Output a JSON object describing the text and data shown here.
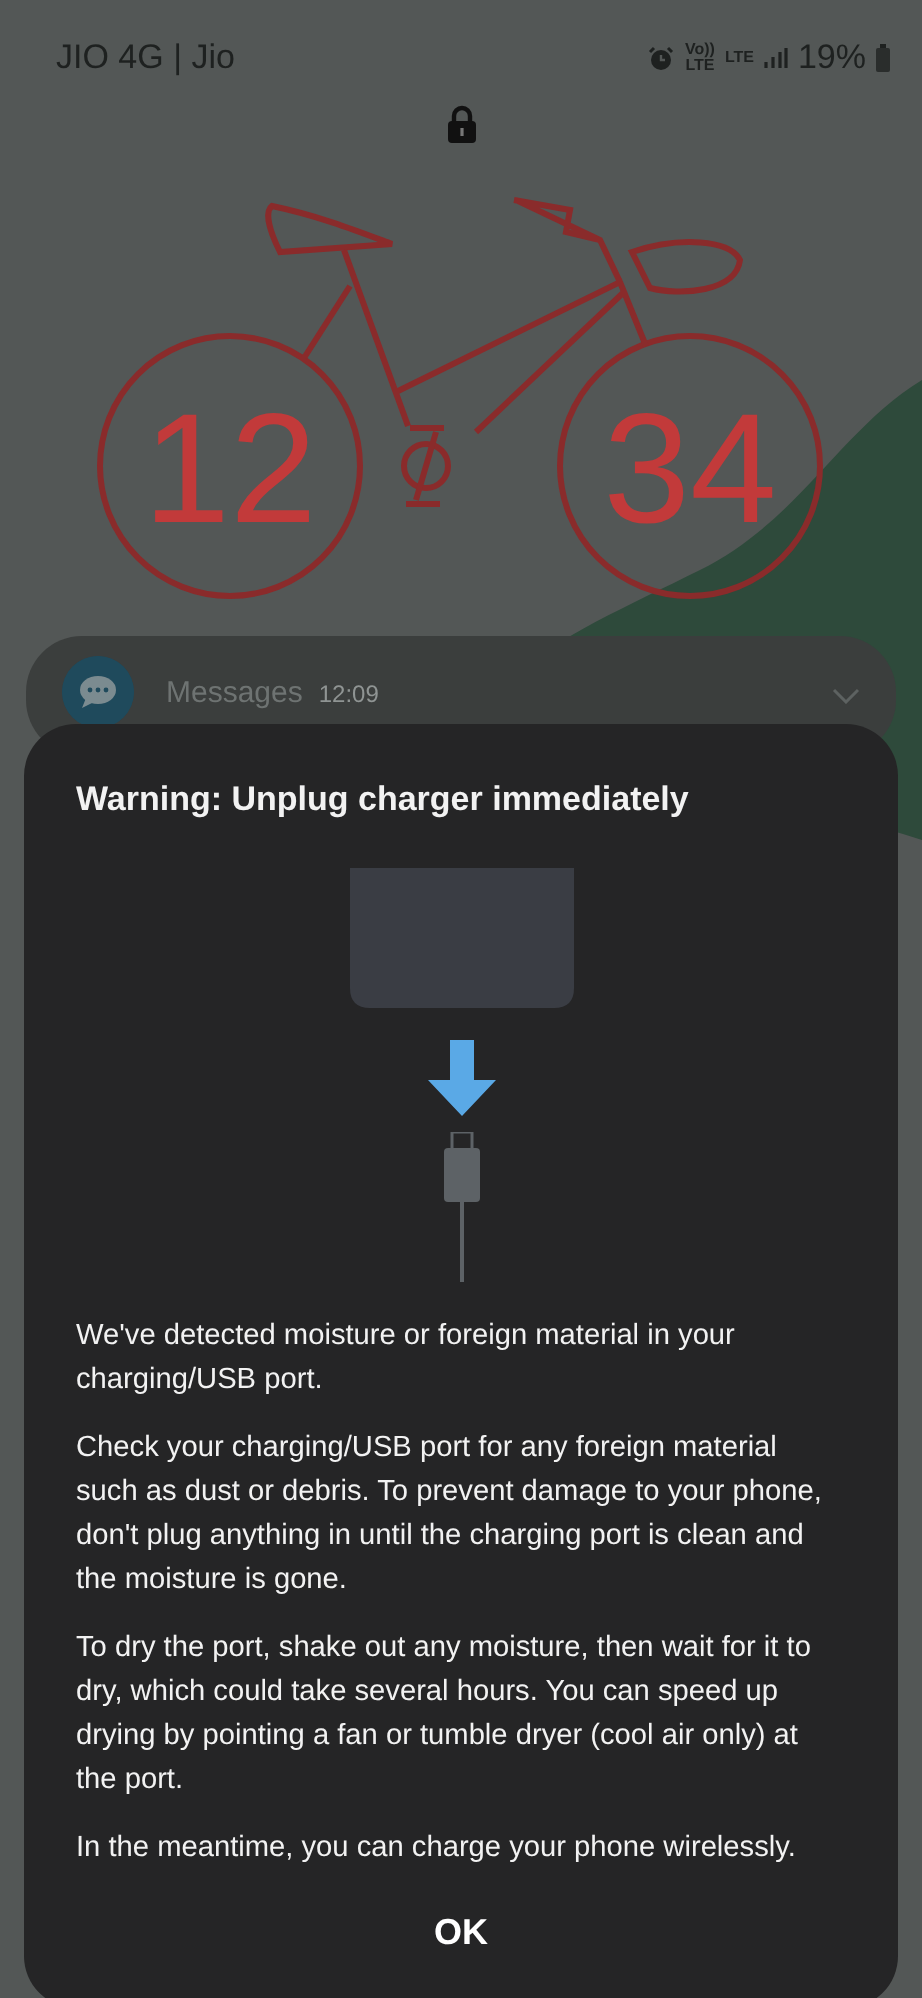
{
  "status_bar": {
    "carrier": "JIO 4G | Jio",
    "volte": "Vo))\nLTE",
    "lte": "LTE",
    "battery_percent": "19%"
  },
  "clock": {
    "hours": "12",
    "minutes": "34"
  },
  "notification": {
    "app": "Messages",
    "time": "12:09"
  },
  "dialog": {
    "title": "Warning: Unplug charger immediately",
    "paragraphs": [
      "We've detected moisture or foreign material in your charging/USB port.",
      "Check your charging/USB port for any foreign material such as dust or debris. To prevent damage to your phone, don't plug anything in until the charging port is clean and the moisture is gone.",
      "To dry the port, shake out any moisture, then wait for it to dry, which could take several hours. You can speed up drying by pointing a fan or tumble dryer (cool air only) at the port.",
      "In the meantime, you can charge your phone wirelessly."
    ],
    "button": "OK"
  }
}
